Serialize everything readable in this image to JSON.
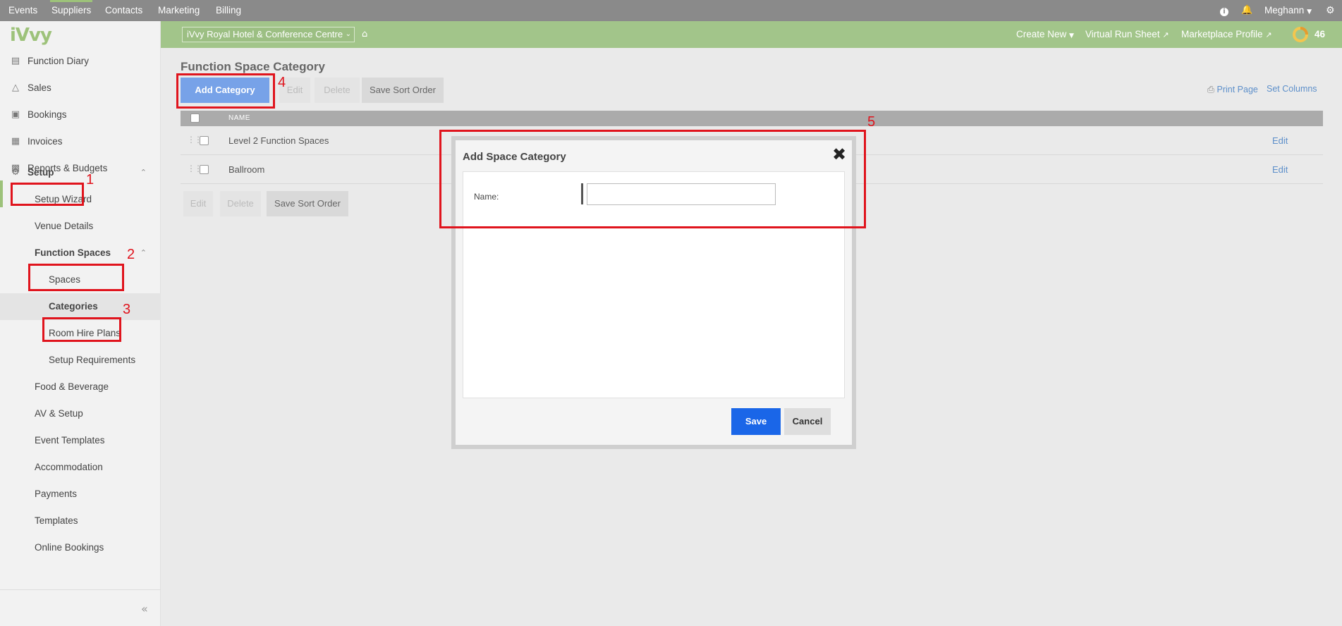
{
  "topnav": {
    "items": [
      "Events",
      "Suppliers",
      "Contacts",
      "Marketing",
      "Billing"
    ],
    "user": "Meghann",
    "info_icon": "info-icon",
    "bell_icon": "bell-icon",
    "gear_icon": "gear-icon"
  },
  "greenbar": {
    "venue": "iVvy Royal Hotel & Conference Centre",
    "create_new": "Create New",
    "virtual_run_sheet": "Virtual Run Sheet",
    "marketplace_profile": "Marketplace Profile",
    "score": "46"
  },
  "sidebar": {
    "logo": "iVvy",
    "items": [
      {
        "label": "Function Diary",
        "icon": "calendar-icon"
      },
      {
        "label": "Sales",
        "icon": "sales-icon"
      },
      {
        "label": "Bookings",
        "icon": "briefcase-icon"
      },
      {
        "label": "Invoices",
        "icon": "invoice-icon"
      },
      {
        "label": "Reports & Budgets",
        "icon": "chart-icon"
      },
      {
        "label": "Setup",
        "icon": "gear-icon"
      },
      {
        "label": "Setup Wizard"
      },
      {
        "label": "Venue Details"
      },
      {
        "label": "Function Spaces"
      },
      {
        "label": "Spaces"
      },
      {
        "label": "Categories"
      },
      {
        "label": "Room Hire Plans"
      },
      {
        "label": "Setup Requirements"
      },
      {
        "label": "Food & Beverage"
      },
      {
        "label": "AV & Setup"
      },
      {
        "label": "Event Templates"
      },
      {
        "label": "Accommodation"
      },
      {
        "label": "Payments"
      },
      {
        "label": "Templates"
      },
      {
        "label": "Online Bookings"
      }
    ]
  },
  "main": {
    "title": "Function Space Category",
    "buttons": {
      "add_category": "Add Category",
      "edit": "Edit",
      "delete": "Delete",
      "save_sort_order": "Save Sort Order"
    },
    "print_page": "Print Page",
    "set_columns": "Set Columns",
    "table": {
      "header": "NAME",
      "rows": [
        {
          "name": "Level 2 Function Spaces",
          "action": "Edit"
        },
        {
          "name": "Ballroom",
          "action": "Edit"
        }
      ]
    }
  },
  "modal": {
    "title": "Add Space Category",
    "name_label": "Name:",
    "name_value": "",
    "save": "Save",
    "cancel": "Cancel"
  },
  "annotations": [
    "1",
    "2",
    "3",
    "4",
    "5"
  ]
}
